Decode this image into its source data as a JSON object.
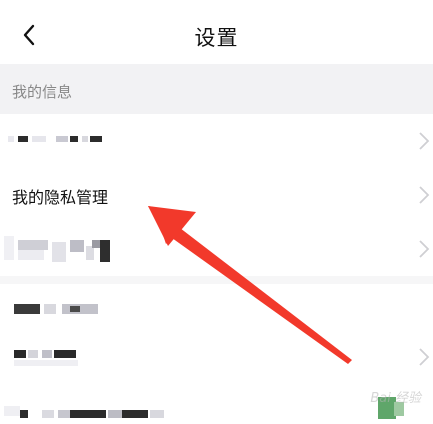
{
  "header": {
    "title": "设置",
    "back_icon": "chevron-left-icon"
  },
  "section": {
    "label": "我的信息"
  },
  "rows": [
    {
      "label": "",
      "blurred": true
    },
    {
      "label": "我的隐私管理",
      "blurred": false
    },
    {
      "label": "",
      "blurred": true
    },
    {
      "label": "",
      "blurred": true
    },
    {
      "label": "",
      "blurred": true
    },
    {
      "label": "",
      "blurred": true
    }
  ],
  "annotation": {
    "arrow_color": "#f2392b"
  },
  "watermark": {
    "text": "Bai 经验"
  },
  "colors": {
    "background": "#ffffff",
    "section_background": "#f2f2f4",
    "chevron": "#cfcfd3",
    "text": "#111111",
    "muted_text": "#888888"
  }
}
